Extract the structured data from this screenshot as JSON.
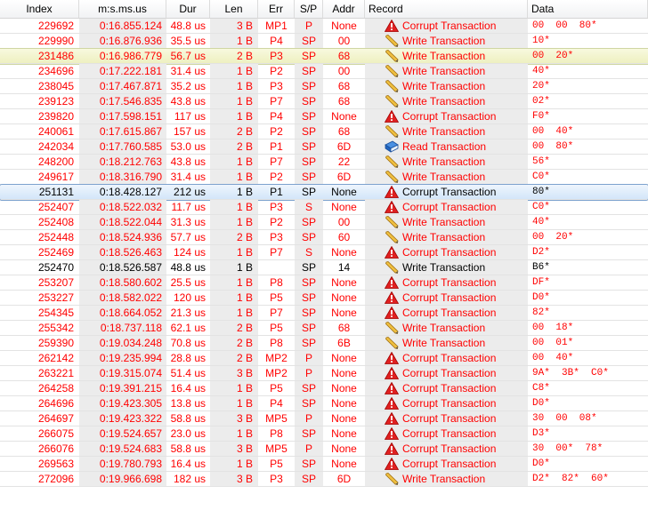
{
  "columns": {
    "index": "Index",
    "time": "m:s.ms.us",
    "dur": "Dur",
    "len": "Len",
    "err": "Err",
    "sp": "S/P",
    "addr": "Addr",
    "record": "Record",
    "data": "Data"
  },
  "colors": {
    "error_text": "#ff0000",
    "normal_text": "#000000",
    "selection_blue": "#d3e6f9",
    "selection_yellow": "#eef0c0"
  },
  "rows": [
    {
      "index": "229692",
      "time": "0:16.855.124",
      "dur": "48.8 us",
      "len": "3 B",
      "err": "MP1",
      "sp": "P",
      "addr": "None",
      "icon": "warning-icon",
      "record": "Corrupt Transaction",
      "data": "00 00 80*",
      "state": "error"
    },
    {
      "index": "229990",
      "time": "0:16.876.936",
      "dur": "35.5 us",
      "len": "1 B",
      "err": "P4",
      "sp": "SP",
      "addr": "00",
      "icon": "pencil-icon",
      "record": "Write Transaction",
      "data": "10*",
      "state": "error"
    },
    {
      "index": "231486",
      "time": "0:16.986.779",
      "dur": "56.7 us",
      "len": "2 B",
      "err": "P3",
      "sp": "SP",
      "addr": "68",
      "icon": "pencil-icon",
      "record": "Write Transaction",
      "data": "00 20*",
      "state": "error",
      "highlight": "yellow"
    },
    {
      "index": "234696",
      "time": "0:17.222.181",
      "dur": "31.4 us",
      "len": "1 B",
      "err": "P2",
      "sp": "SP",
      "addr": "00",
      "icon": "pencil-icon",
      "record": "Write Transaction",
      "data": "40*",
      "state": "error"
    },
    {
      "index": "238045",
      "time": "0:17.467.871",
      "dur": "35.2 us",
      "len": "1 B",
      "err": "P3",
      "sp": "SP",
      "addr": "68",
      "icon": "pencil-icon",
      "record": "Write Transaction",
      "data": "20*",
      "state": "error"
    },
    {
      "index": "239123",
      "time": "0:17.546.835",
      "dur": "43.8 us",
      "len": "1 B",
      "err": "P7",
      "sp": "SP",
      "addr": "68",
      "icon": "pencil-icon",
      "record": "Write Transaction",
      "data": "02*",
      "state": "error"
    },
    {
      "index": "239820",
      "time": "0:17.598.151",
      "dur": "117 us",
      "len": "1 B",
      "err": "P4",
      "sp": "SP",
      "addr": "None",
      "icon": "warning-icon",
      "record": "Corrupt Transaction",
      "data": "F0*",
      "state": "error"
    },
    {
      "index": "240061",
      "time": "0:17.615.867",
      "dur": "157 us",
      "len": "2 B",
      "err": "P2",
      "sp": "SP",
      "addr": "68",
      "icon": "pencil-icon",
      "record": "Write Transaction",
      "data": "00 40*",
      "state": "error"
    },
    {
      "index": "242034",
      "time": "0:17.760.585",
      "dur": "53.0 us",
      "len": "2 B",
      "err": "P1",
      "sp": "SP",
      "addr": "6D",
      "icon": "book-icon",
      "record": "Read Transaction",
      "data": "00 80*",
      "state": "error"
    },
    {
      "index": "248200",
      "time": "0:18.212.763",
      "dur": "43.8 us",
      "len": "1 B",
      "err": "P7",
      "sp": "SP",
      "addr": "22",
      "icon": "pencil-icon",
      "record": "Write Transaction",
      "data": "56*",
      "state": "error"
    },
    {
      "index": "249617",
      "time": "0:18.316.790",
      "dur": "31.4 us",
      "len": "1 B",
      "err": "P2",
      "sp": "SP",
      "addr": "6D",
      "icon": "pencil-icon",
      "record": "Write Transaction",
      "data": "C0*",
      "state": "error"
    },
    {
      "index": "251131",
      "time": "0:18.428.127",
      "dur": "212 us",
      "len": "1 B",
      "err": "P1",
      "sp": "SP",
      "addr": "None",
      "icon": "warning-icon",
      "record": "Corrupt Transaction",
      "data": "80*",
      "state": "normal",
      "highlight": "blue"
    },
    {
      "index": "252407",
      "time": "0:18.522.032",
      "dur": "11.7 us",
      "len": "1 B",
      "err": "P3",
      "sp": "S",
      "addr": "None",
      "icon": "warning-icon",
      "record": "Corrupt Transaction",
      "data": "C0*",
      "state": "error"
    },
    {
      "index": "252408",
      "time": "0:18.522.044",
      "dur": "31.3 us",
      "len": "1 B",
      "err": "P2",
      "sp": "SP",
      "addr": "00",
      "icon": "pencil-icon",
      "record": "Write Transaction",
      "data": "40*",
      "state": "error"
    },
    {
      "index": "252448",
      "time": "0:18.524.936",
      "dur": "57.7 us",
      "len": "2 B",
      "err": "P3",
      "sp": "SP",
      "addr": "60",
      "icon": "pencil-icon",
      "record": "Write Transaction",
      "data": "00 20*",
      "state": "error"
    },
    {
      "index": "252469",
      "time": "0:18.526.463",
      "dur": "124 us",
      "len": "1 B",
      "err": "P7",
      "sp": "S",
      "addr": "None",
      "icon": "warning-icon",
      "record": "Corrupt Transaction",
      "data": "D2*",
      "state": "error"
    },
    {
      "index": "252470",
      "time": "0:18.526.587",
      "dur": "48.8 us",
      "len": "1 B",
      "err": "",
      "sp": "SP",
      "addr": "14",
      "icon": "pencil-icon",
      "record": "Write Transaction",
      "data": "B6*",
      "state": "normal"
    },
    {
      "index": "253207",
      "time": "0:18.580.602",
      "dur": "25.5 us",
      "len": "1 B",
      "err": "P8",
      "sp": "SP",
      "addr": "None",
      "icon": "warning-icon",
      "record": "Corrupt Transaction",
      "data": "DF*",
      "state": "error"
    },
    {
      "index": "253227",
      "time": "0:18.582.022",
      "dur": "120 us",
      "len": "1 B",
      "err": "P5",
      "sp": "SP",
      "addr": "None",
      "icon": "warning-icon",
      "record": "Corrupt Transaction",
      "data": "D0*",
      "state": "error"
    },
    {
      "index": "254345",
      "time": "0:18.664.052",
      "dur": "21.3 us",
      "len": "1 B",
      "err": "P7",
      "sp": "SP",
      "addr": "None",
      "icon": "warning-icon",
      "record": "Corrupt Transaction",
      "data": "82*",
      "state": "error"
    },
    {
      "index": "255342",
      "time": "0:18.737.118",
      "dur": "62.1 us",
      "len": "2 B",
      "err": "P5",
      "sp": "SP",
      "addr": "68",
      "icon": "pencil-icon",
      "record": "Write Transaction",
      "data": "00 18*",
      "state": "error"
    },
    {
      "index": "259390",
      "time": "0:19.034.248",
      "dur": "70.8 us",
      "len": "2 B",
      "err": "P8",
      "sp": "SP",
      "addr": "6B",
      "icon": "pencil-icon",
      "record": "Write Transaction",
      "data": "00 01*",
      "state": "error"
    },
    {
      "index": "262142",
      "time": "0:19.235.994",
      "dur": "28.8 us",
      "len": "2 B",
      "err": "MP2",
      "sp": "P",
      "addr": "None",
      "icon": "warning-icon",
      "record": "Corrupt Transaction",
      "data": "00 40*",
      "state": "error"
    },
    {
      "index": "263221",
      "time": "0:19.315.074",
      "dur": "51.4 us",
      "len": "3 B",
      "err": "MP2",
      "sp": "P",
      "addr": "None",
      "icon": "warning-icon",
      "record": "Corrupt Transaction",
      "data": "9A* 3B* C0*",
      "state": "error"
    },
    {
      "index": "264258",
      "time": "0:19.391.215",
      "dur": "16.4 us",
      "len": "1 B",
      "err": "P5",
      "sp": "SP",
      "addr": "None",
      "icon": "warning-icon",
      "record": "Corrupt Transaction",
      "data": "C8*",
      "state": "error"
    },
    {
      "index": "264696",
      "time": "0:19.423.305",
      "dur": "13.8 us",
      "len": "1 B",
      "err": "P4",
      "sp": "SP",
      "addr": "None",
      "icon": "warning-icon",
      "record": "Corrupt Transaction",
      "data": "D0*",
      "state": "error"
    },
    {
      "index": "264697",
      "time": "0:19.423.322",
      "dur": "58.8 us",
      "len": "3 B",
      "err": "MP5",
      "sp": "P",
      "addr": "None",
      "icon": "warning-icon",
      "record": "Corrupt Transaction",
      "data": "30 00 08*",
      "state": "error"
    },
    {
      "index": "266075",
      "time": "0:19.524.657",
      "dur": "23.0 us",
      "len": "1 B",
      "err": "P8",
      "sp": "SP",
      "addr": "None",
      "icon": "warning-icon",
      "record": "Corrupt Transaction",
      "data": "D3*",
      "state": "error"
    },
    {
      "index": "266076",
      "time": "0:19.524.683",
      "dur": "58.8 us",
      "len": "3 B",
      "err": "MP5",
      "sp": "P",
      "addr": "None",
      "icon": "warning-icon",
      "record": "Corrupt Transaction",
      "data": "30 00* 78*",
      "state": "error"
    },
    {
      "index": "269563",
      "time": "0:19.780.793",
      "dur": "16.4 us",
      "len": "1 B",
      "err": "P5",
      "sp": "SP",
      "addr": "None",
      "icon": "warning-icon",
      "record": "Corrupt Transaction",
      "data": "D0*",
      "state": "error"
    },
    {
      "index": "272096",
      "time": "0:19.966.698",
      "dur": "182 us",
      "len": "3 B",
      "err": "P3",
      "sp": "SP",
      "addr": "6D",
      "icon": "pencil-icon",
      "record": "Write Transaction",
      "data": "D2* 82* 60*",
      "state": "error"
    }
  ]
}
